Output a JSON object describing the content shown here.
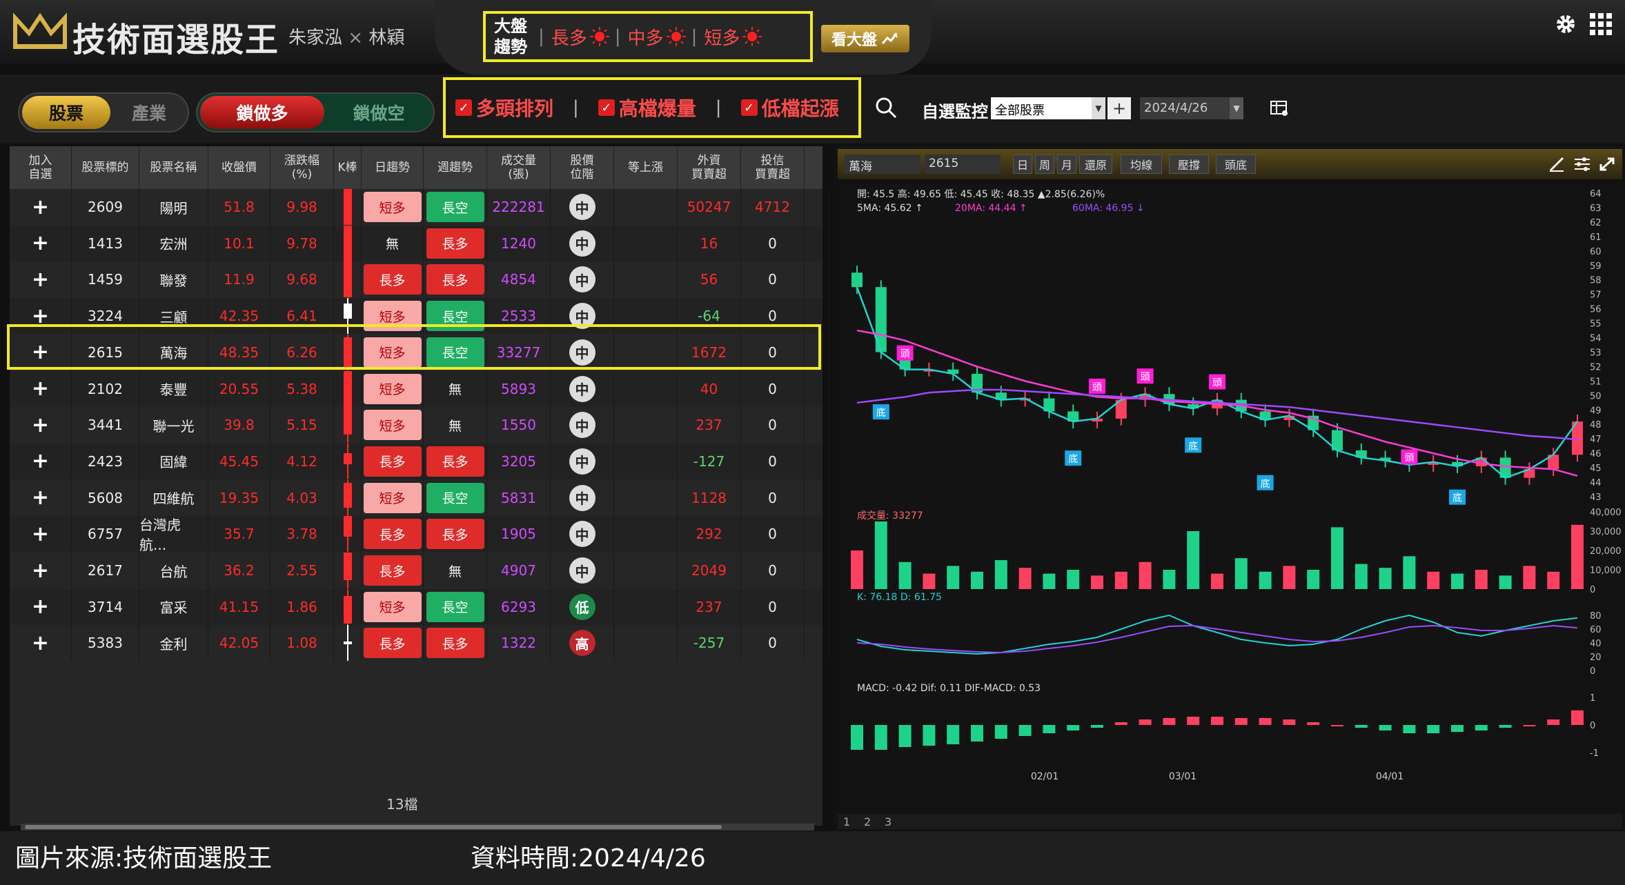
{
  "header": {
    "app_title": "技術面選股王",
    "authors_a": "朱家泓",
    "authors_x": "×",
    "authors_b": "林穎",
    "trend_title_1": "大盤",
    "trend_title_2": "趨勢",
    "trend_long": "長多",
    "trend_mid": "中多",
    "trend_short": "短多",
    "view_market": "看大盤",
    "sun_color": "#ff2020"
  },
  "toolbar": {
    "stock": "股票",
    "industry": "產業",
    "lock_long": "鎖做多",
    "lock_short": "鎖做空",
    "filter_1": "多頭排列",
    "filter_2": "高檔爆量",
    "filter_3": "低檔起漲",
    "check": "✓",
    "sep": "|",
    "watch_label": "自選監控",
    "watch_value": "全部股票",
    "add": "+",
    "date_value": "2024/4/26"
  },
  "table": {
    "headers": [
      "加入\n自選",
      "股票標的",
      "股票名稱",
      "收盤價",
      "漲跌幅\n(%)",
      "K棒",
      "日趨勢",
      "週趨勢",
      "成交量\n(張)",
      "股價\n位階",
      "等上漲",
      "外資\n買賣超",
      "投信\n買賣超"
    ],
    "rows": [
      {
        "code": "2609",
        "name": "陽明",
        "close": "51.8",
        "chg": "9.98",
        "day": "短多",
        "week": "長空",
        "vol": "222281",
        "pos": "中",
        "foreign": "50247",
        "trust": "4712",
        "fc": "red"
      },
      {
        "code": "1413",
        "name": "宏洲",
        "close": "10.1",
        "chg": "9.78",
        "day": "無",
        "week": "長多",
        "vol": "1240",
        "pos": "中",
        "foreign": "16",
        "trust": "0",
        "fc": "red"
      },
      {
        "code": "1459",
        "name": "聯發",
        "close": "11.9",
        "chg": "9.68",
        "day": "長多",
        "week": "長多",
        "vol": "4854",
        "pos": "中",
        "foreign": "56",
        "trust": "0",
        "fc": "red"
      },
      {
        "code": "3224",
        "name": "三顧",
        "close": "42.35",
        "chg": "6.41",
        "day": "短多",
        "week": "長空",
        "vol": "2533",
        "pos": "中",
        "foreign": "-64",
        "trust": "0",
        "fc": "green"
      },
      {
        "code": "2615",
        "name": "萬海",
        "close": "48.35",
        "chg": "6.26",
        "day": "短多",
        "week": "長空",
        "vol": "33277",
        "pos": "中",
        "foreign": "1672",
        "trust": "0",
        "fc": "red"
      },
      {
        "code": "2102",
        "name": "泰豐",
        "close": "20.55",
        "chg": "5.38",
        "day": "短多",
        "week": "無",
        "vol": "5893",
        "pos": "中",
        "foreign": "40",
        "trust": "0",
        "fc": "red"
      },
      {
        "code": "3441",
        "name": "聯一光",
        "close": "39.8",
        "chg": "5.15",
        "day": "短多",
        "week": "無",
        "vol": "1550",
        "pos": "中",
        "foreign": "237",
        "trust": "0",
        "fc": "red"
      },
      {
        "code": "2423",
        "name": "固緯",
        "close": "45.45",
        "chg": "4.12",
        "day": "長多",
        "week": "長多",
        "vol": "3205",
        "pos": "中",
        "foreign": "-127",
        "trust": "0",
        "fc": "green"
      },
      {
        "code": "5608",
        "name": "四維航",
        "close": "19.35",
        "chg": "4.03",
        "day": "短多",
        "week": "長空",
        "vol": "5831",
        "pos": "中",
        "foreign": "1128",
        "trust": "0",
        "fc": "red"
      },
      {
        "code": "6757",
        "name": "台灣虎航...",
        "close": "35.7",
        "chg": "3.78",
        "day": "長多",
        "week": "長多",
        "vol": "1905",
        "pos": "中",
        "foreign": "292",
        "trust": "0",
        "fc": "red"
      },
      {
        "code": "2617",
        "name": "台航",
        "close": "36.2",
        "chg": "2.55",
        "day": "長多",
        "week": "無",
        "vol": "4907",
        "pos": "中",
        "foreign": "2049",
        "trust": "0",
        "fc": "red"
      },
      {
        "code": "3714",
        "name": "富采",
        "close": "41.15",
        "chg": "1.86",
        "day": "短多",
        "week": "長空",
        "vol": "6293",
        "pos": "低",
        "foreign": "237",
        "trust": "0",
        "fc": "red"
      },
      {
        "code": "5383",
        "name": "金利",
        "close": "42.05",
        "chg": "1.08",
        "day": "長多",
        "week": "長多",
        "vol": "1322",
        "pos": "高",
        "foreign": "-257",
        "trust": "0",
        "fc": "green"
      }
    ],
    "plus": "+",
    "count": "13檔"
  },
  "chart": {
    "code_name": "萬海",
    "code": "2615",
    "tabs": [
      "日",
      "周",
      "月",
      "還原",
      "均線",
      "壓撐",
      "頭底"
    ],
    "ohlc_line": "開: 45.5  高: 49.65  低: 45.45  收: 48.35  ▲2.85(6.26)%",
    "ma_5": "5MA: 45.62 ↑",
    "ma_20": "20MA: 44.44 ↑",
    "ma_60": "60MA: 46.95 ↓",
    "vol_label": "成交量: 33277",
    "kd_label": "K: 76.18  D: 61.75",
    "macd_label": "MACD: -0.42  Dif: 0.11  DIF-MACD: 0.53",
    "date_ticks": [
      "02/01",
      "03/01",
      "04/01"
    ],
    "pages": [
      "1",
      "2",
      "3"
    ],
    "head_mark": "頭",
    "bottom_mark": "底"
  },
  "chart_data": {
    "type": "line",
    "title": "萬海",
    "price_axis": [
      "64",
      "63",
      "62",
      "61",
      "60",
      "59",
      "58",
      "57",
      "56",
      "55",
      "54",
      "53",
      "52",
      "51",
      "50",
      "49",
      "48",
      "47",
      "46",
      "45",
      "44",
      "43"
    ],
    "volume_axis": [
      "40,000",
      "30,000",
      "20,000",
      "10,000",
      "0"
    ],
    "kd_axis": [
      "80",
      "60",
      "40",
      "20",
      "0"
    ],
    "macd_axis": [
      "1",
      "0",
      "-1"
    ],
    "ylim": [
      43,
      64
    ],
    "series": [
      {
        "name": "5MA",
        "values": [
          57.5,
          53,
          51.8,
          51.8,
          51.5,
          50.2,
          49.7,
          49.8,
          48.9,
          48.2,
          48.4,
          49.7,
          50.1,
          49.4,
          49.1,
          49.7,
          48.9,
          48.3,
          48.6,
          47.6,
          46.2,
          45.7,
          45.5,
          45.2,
          45.4,
          45.1,
          45.7,
          44.3,
          44.9,
          45.9,
          48.2
        ]
      },
      {
        "name": "20MA",
        "values": [
          54.5,
          54.2,
          53.8,
          53.2,
          52.6,
          52,
          51.5,
          51,
          50.6,
          50.2,
          49.9,
          49.8,
          49.8,
          49.6,
          49.5,
          49.4,
          49.3,
          49,
          48.8,
          48.4,
          47.8,
          47.3,
          46.8,
          46.4,
          46,
          45.6,
          45.3,
          45.1,
          45,
          44.9,
          44.44
        ]
      },
      {
        "name": "60MA",
        "values": [
          49.5,
          49.7,
          49.9,
          50.2,
          50.3,
          50.4,
          50.4,
          50.3,
          50.2,
          50.1,
          50,
          49.9,
          49.8,
          49.7,
          49.6,
          49.5,
          49.4,
          49.3,
          49.2,
          49,
          48.8,
          48.6,
          48.4,
          48.2,
          48,
          47.8,
          47.6,
          47.4,
          47.2,
          47.1,
          46.95
        ]
      }
    ],
    "volume": [
      20000,
      35000,
      14000,
      8000,
      12000,
      9000,
      15000,
      11000,
      8000,
      10000,
      7000,
      9000,
      14000,
      10000,
      30000,
      8000,
      16000,
      9000,
      12000,
      10000,
      32000,
      13000,
      11000,
      17000,
      9000,
      8000,
      10000,
      7000,
      12000,
      9000,
      33277
    ],
    "k": [
      45,
      35,
      30,
      28,
      26,
      24,
      26,
      32,
      38,
      42,
      48,
      60,
      72,
      80,
      65,
      55,
      45,
      40,
      36,
      38,
      45,
      60,
      72,
      80,
      70,
      55,
      50,
      58,
      65,
      72,
      76.18
    ],
    "d": [
      40,
      38,
      34,
      31,
      29,
      27,
      26,
      28,
      32,
      36,
      41,
      48,
      56,
      64,
      65,
      60,
      55,
      50,
      45,
      42,
      43,
      48,
      55,
      63,
      65,
      62,
      58,
      58,
      61,
      65,
      61.75
    ],
    "macd_hist": [
      -0.9,
      -0.9,
      -0.8,
      -0.75,
      -0.7,
      -0.6,
      -0.5,
      -0.4,
      -0.3,
      -0.2,
      -0.1,
      0.1,
      0.2,
      0.25,
      0.3,
      0.3,
      0.25,
      0.25,
      0.2,
      0.1,
      0,
      -0.1,
      -0.2,
      -0.3,
      -0.3,
      -0.25,
      -0.2,
      -0.1,
      0,
      0.2,
      0.53
    ]
  },
  "footer": {
    "source": "圖片來源:技術面選股王",
    "time": "資料時間:2024/4/26"
  },
  "colors": {
    "accent_yellow": "#f1ea27",
    "up_red": "#ff2a2a",
    "down_green": "#1fae63",
    "gold": "#d8b24a"
  }
}
